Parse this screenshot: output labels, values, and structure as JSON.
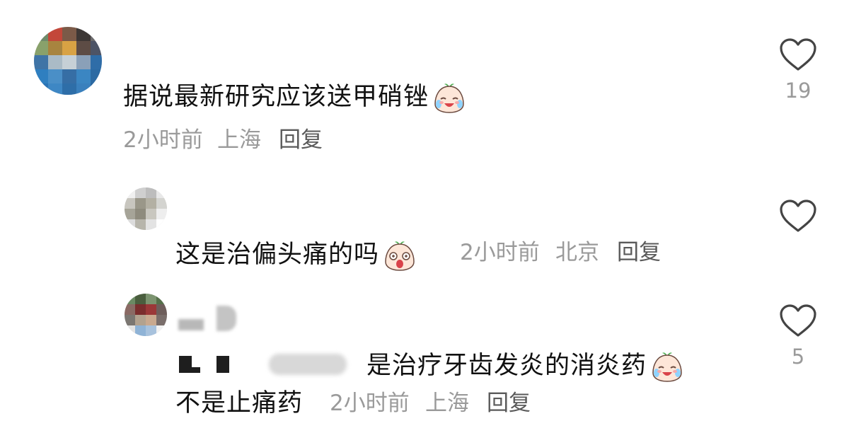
{
  "comments": [
    {
      "text": "据说最新研究应该送甲硝锉",
      "emoji": "crying-laughing-sticker",
      "time": "2小时前",
      "location": "上海",
      "reply_label": "回复",
      "likes": "19"
    },
    {
      "text": "这是治偏头痛的吗",
      "emoji": "surprised-sticker",
      "time": "2小时前",
      "location": "北京",
      "reply_label": "回复",
      "likes": ""
    },
    {
      "text": "是治疗牙齿发炎的消炎药",
      "text_line2": "不是止痛药",
      "emoji": "crying-laughing-sticker",
      "time": "2小时前",
      "location": "上海",
      "reply_label": "回复",
      "likes": "5"
    }
  ],
  "colors": {
    "meta_gray": "#9a9a9a",
    "text": "#111111",
    "heart_stroke": "#444444"
  }
}
